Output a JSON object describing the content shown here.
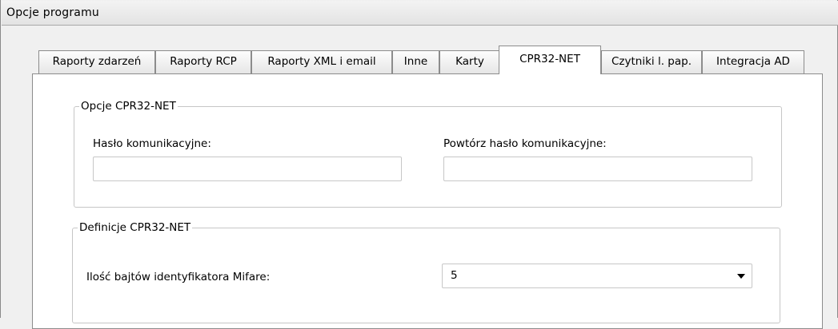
{
  "window": {
    "title": "Opcje programu"
  },
  "tabs": [
    {
      "label": "Raporty zdarzeń",
      "active": false
    },
    {
      "label": "Raporty RCP",
      "active": false
    },
    {
      "label": "Raporty XML i email",
      "active": false
    },
    {
      "label": "Inne",
      "active": false
    },
    {
      "label": "Karty",
      "active": false
    },
    {
      "label": "CPR32-NET",
      "active": true
    },
    {
      "label": "Czytniki l. pap.",
      "active": false
    },
    {
      "label": "Integracja AD",
      "active": false
    }
  ],
  "options_group": {
    "legend": "Opcje CPR32-NET",
    "password_label": "Hasło komunikacyjne:",
    "password_value": "",
    "repeat_password_label": "Powtórz hasło komunikacyjne:",
    "repeat_password_value": ""
  },
  "definitions_group": {
    "legend": "Definicje CPR32-NET",
    "mifare_bytes_label": "Ilość bajtów identyfikatora Mifare:",
    "mifare_bytes_value": "5"
  }
}
